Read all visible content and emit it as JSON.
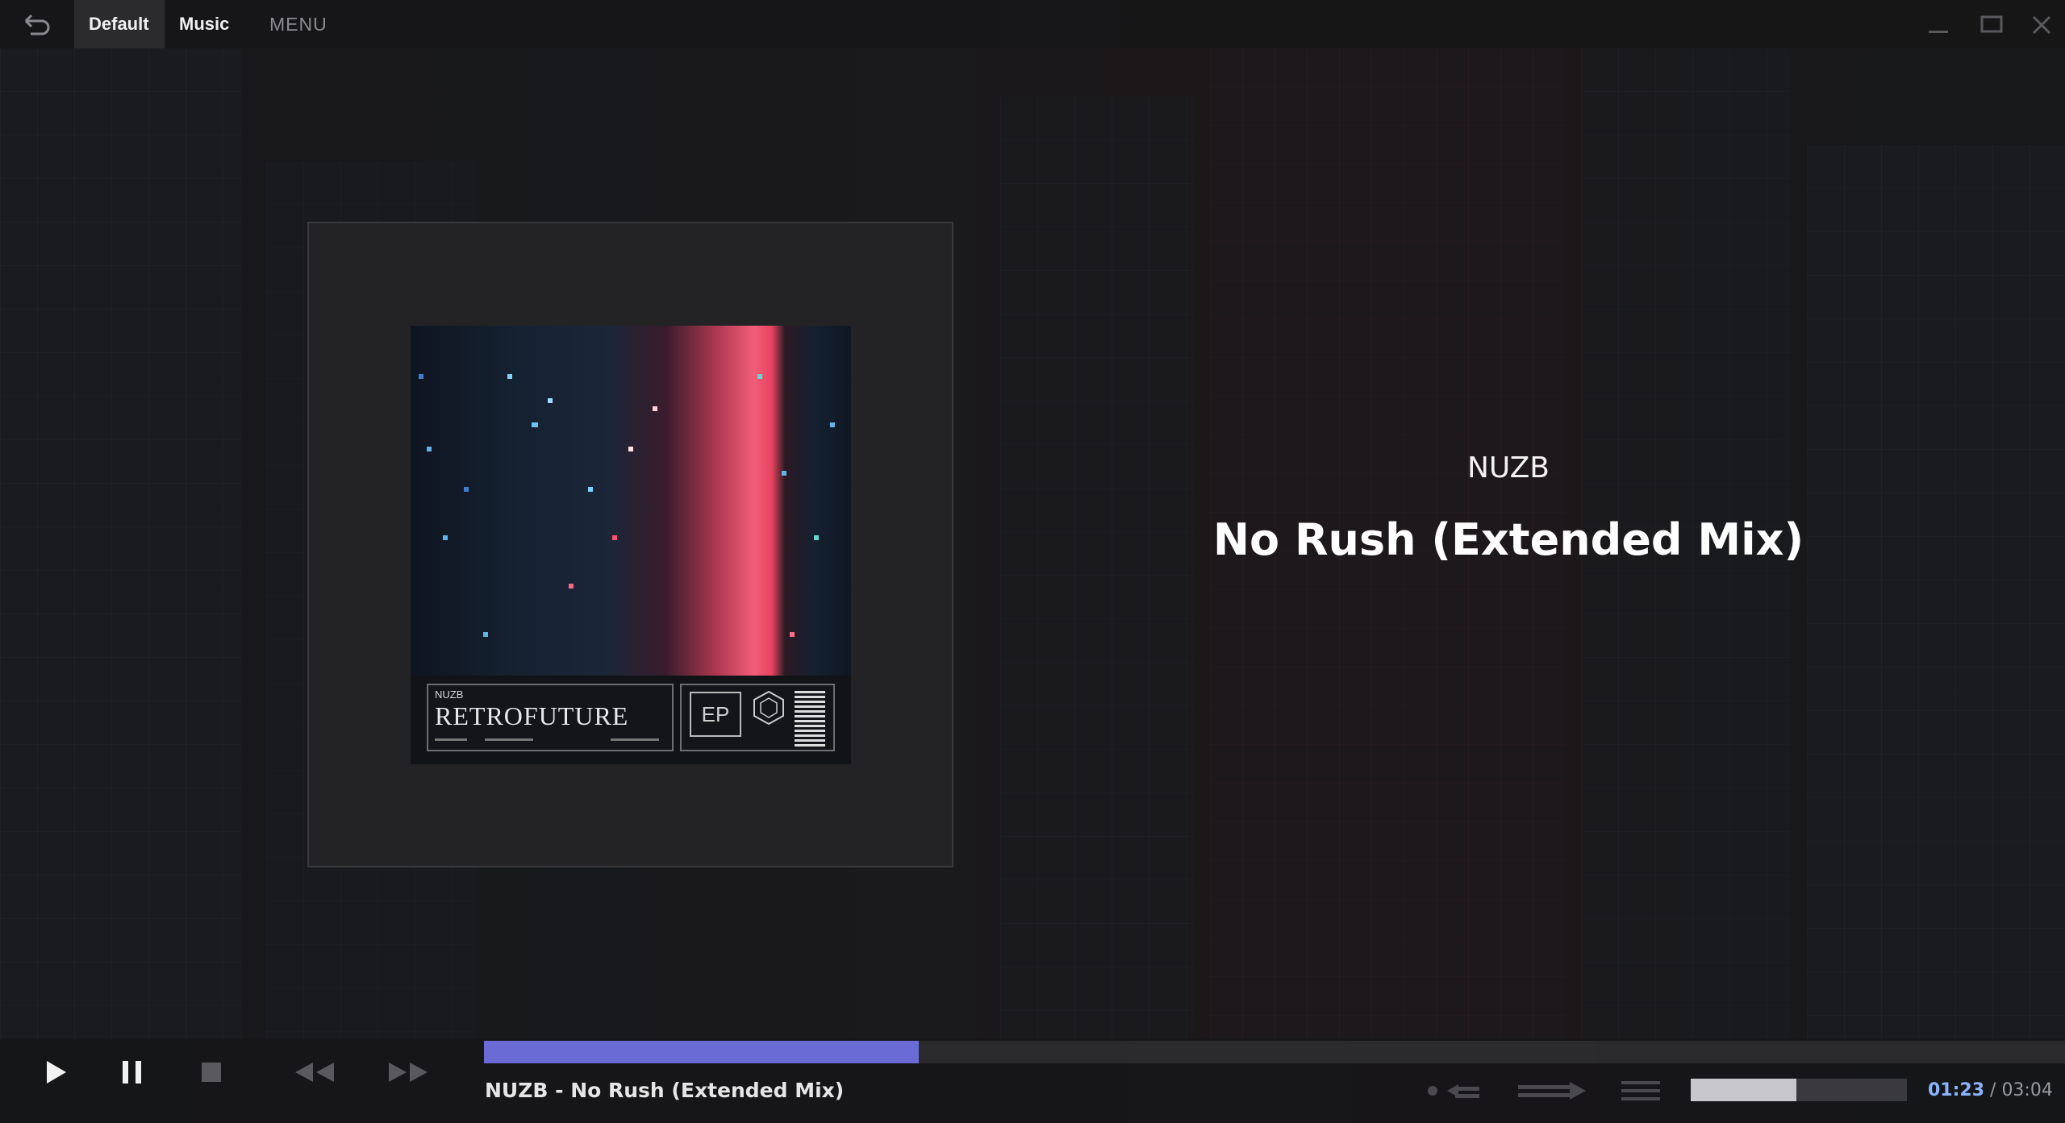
{
  "topbar": {
    "tabs": [
      {
        "label": "Default",
        "active": true
      },
      {
        "label": "Music",
        "active": false
      }
    ],
    "menu_label": "MENU"
  },
  "album_art": {
    "artist": "NUZB",
    "title": "RETROFUTURE",
    "format": "EP"
  },
  "track": {
    "artist": "NUZB",
    "title": "No Rush (Extended Mix)"
  },
  "now_playing": {
    "artist": "NUZB",
    "separator": " - ",
    "title": "No Rush (Extended Mix)"
  },
  "playback": {
    "progress_fraction": 0.275,
    "volume_fraction": 0.49,
    "current_time": "01:23",
    "separator": " / ",
    "total_time": "03:04"
  },
  "colors": {
    "progress": "#6b6bd6",
    "current_time": "#8ab4ff",
    "volume": "#c8c8cc"
  },
  "icons": {
    "back": "undo-arrow-icon",
    "play": "play-icon",
    "pause": "pause-icon",
    "stop": "stop-icon",
    "prev": "rewind-icon",
    "next": "fast-forward-icon",
    "repeat": "repeat-icon",
    "shuffle": "shuffle-icon",
    "playlist": "playlist-icon",
    "minimize": "minimize-icon",
    "maximize": "maximize-icon",
    "close": "close-icon"
  }
}
